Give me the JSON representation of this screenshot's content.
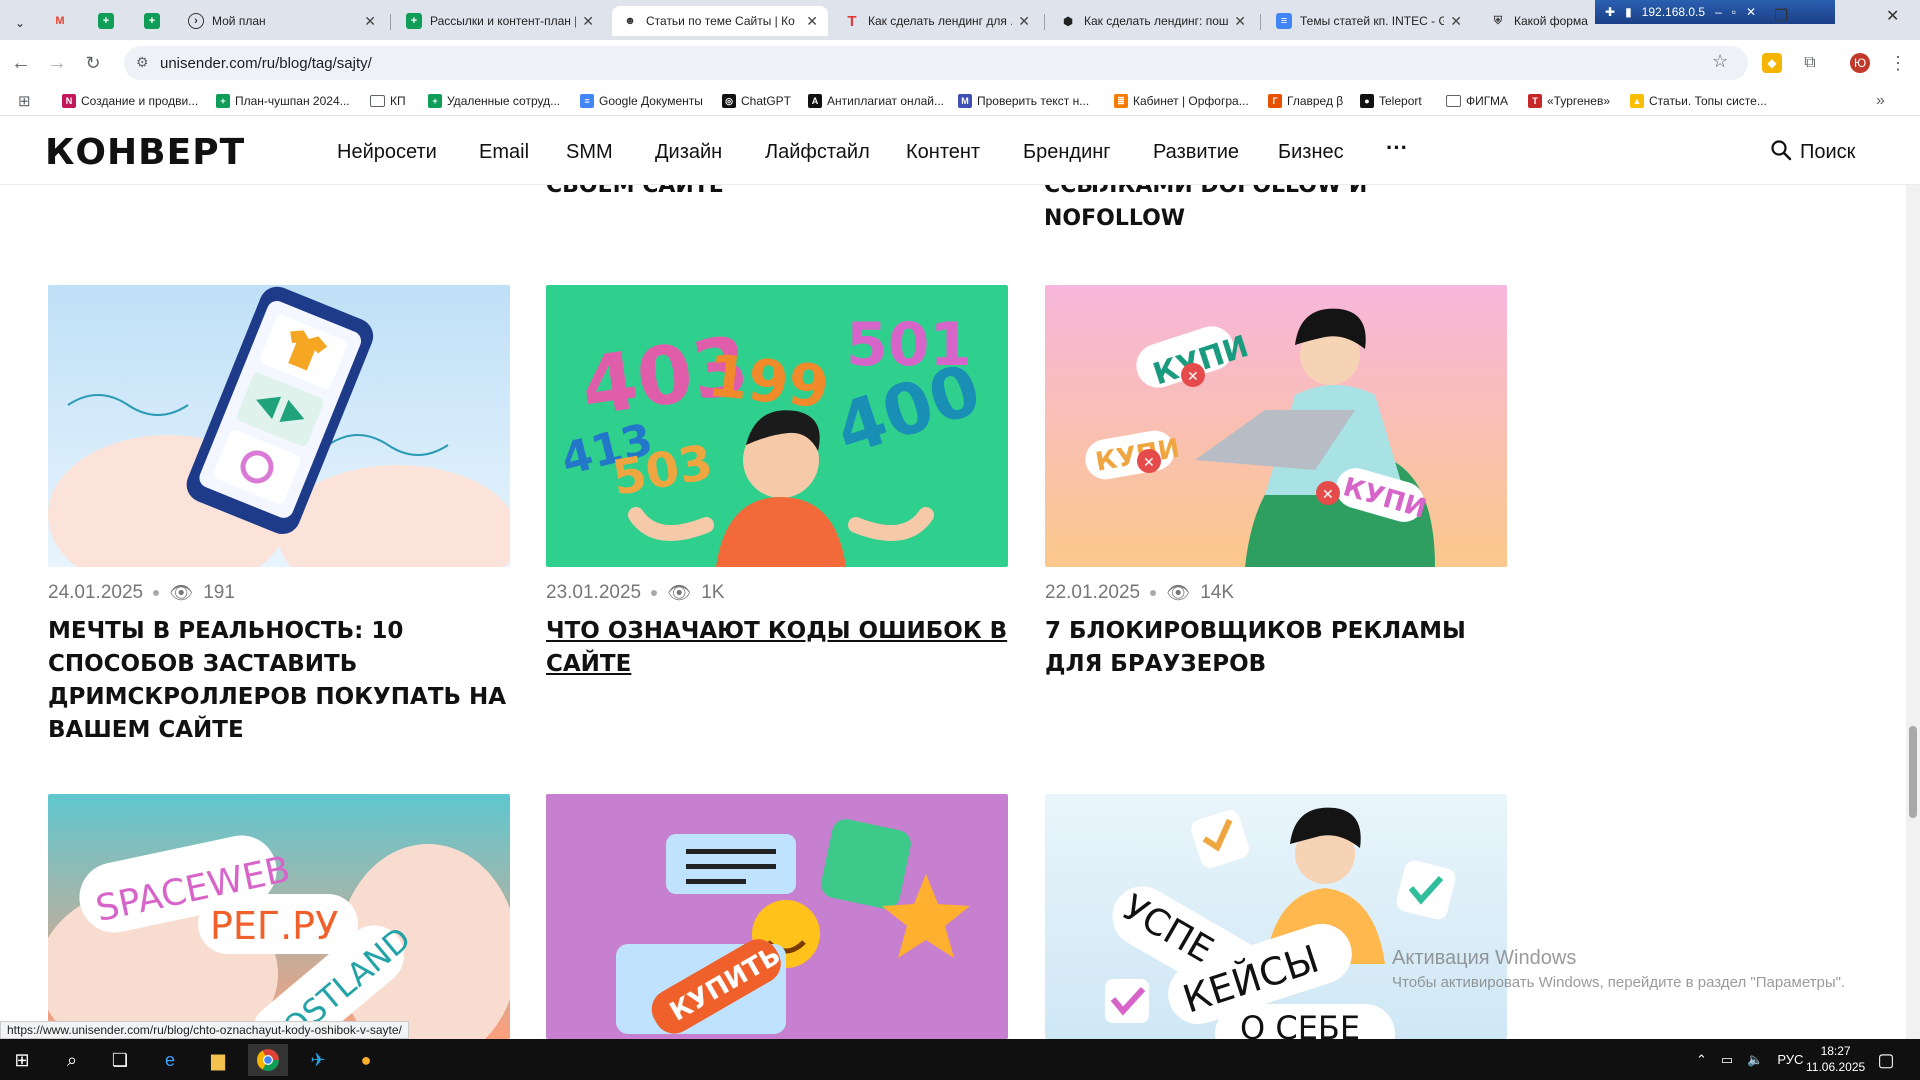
{
  "browser": {
    "tabs": [
      {
        "title": "",
        "icon": "gmail-icon",
        "color": "#ea4335"
      },
      {
        "title": "",
        "icon": "sheets-icon",
        "color": "#0f9d58"
      },
      {
        "title": "",
        "icon": "sheets-icon",
        "color": "#0f9d58"
      },
      {
        "title": "Мой план",
        "icon": "circle-arrow-icon",
        "color": "#333333"
      },
      {
        "title": "Рассылки и контент-план |",
        "icon": "sheets-icon",
        "color": "#0f9d58"
      },
      {
        "title": "Статьи по теме Сайты | Ко",
        "icon": "konvert-icon",
        "color": "#333333"
      },
      {
        "title": "Как сделать лендинг для ...",
        "icon": "text-t-icon",
        "color": "#e53935"
      },
      {
        "title": "Как сделать лендинг: пош...",
        "icon": "hex-icon",
        "color": "#222222"
      },
      {
        "title": "Темы статей кп. INTEC - G",
        "icon": "docs-icon",
        "color": "#4285f4"
      },
      {
        "title": "Какой форма",
        "icon": "shield-icon",
        "color": "#444444"
      }
    ],
    "active_tab_index": 5,
    "network_ip": "192.168.0.5",
    "url": "unisender.com/ru/blog/tag/sajty/",
    "profile_initial": "Ю"
  },
  "bookmarks": [
    {
      "label": "Создание и продви...",
      "icon": "N",
      "color": "#c2185b"
    },
    {
      "label": "План-чушпан 2024...",
      "icon": "+",
      "color": "#0f9d58"
    },
    {
      "label": "КП",
      "icon": "folder",
      "color": "#5f6368"
    },
    {
      "label": "Удаленные сотруд...",
      "icon": "+",
      "color": "#0f9d58"
    },
    {
      "label": "Google Документы",
      "icon": "≡",
      "color": "#4285f4"
    },
    {
      "label": "ChatGPT",
      "icon": "◎",
      "color": "#111111"
    },
    {
      "label": "Антиплагиат онлай...",
      "icon": "A",
      "color": "#111111"
    },
    {
      "label": "Проверить текст н...",
      "icon": "M",
      "color": "#3f51b5"
    },
    {
      "label": "Кабинет | Орфогра...",
      "icon": "≣",
      "color": "#f57c00"
    },
    {
      "label": "Главред β",
      "icon": "Г",
      "color": "#e65100"
    },
    {
      "label": "Teleport",
      "icon": "●",
      "color": "#111111"
    },
    {
      "label": "ФИГМА",
      "icon": "folder",
      "color": "#5f6368"
    },
    {
      "label": "«Тургенев»",
      "icon": "Т",
      "color": "#c62828"
    },
    {
      "label": "Статьи. Топы систе...",
      "icon": "▲",
      "color": "#fbbc04"
    }
  ],
  "site": {
    "logo": "КОНВЕРТ",
    "nav": [
      "Нейросети",
      "Email",
      "SMM",
      "Дизайн",
      "Лайфстайл",
      "Контент",
      "Брендинг",
      "Развитие",
      "Бизнес"
    ],
    "more": "···",
    "search_label": "Поиск",
    "prev_titles": [
      "СВОЕМ САЙТЕ",
      "ССЫЛКАМИ DOFOLLOW И NOFOLLOW"
    ],
    "cards": [
      {
        "date": "24.01.2025",
        "views": "191",
        "title": "МЕЧТЫ В РЕАЛЬНОСТЬ: 10 СПОСОБОВ ЗАСТАВИТЬ ДРИМСКРОЛЛЕРОВ ПОКУПАТЬ НА ВАШЕМ САЙТЕ"
      },
      {
        "date": "23.01.2025",
        "views": "1K",
        "title": "ЧТО ОЗНАЧАЮТ КОДЫ ОШИБОК В САЙТЕ"
      },
      {
        "date": "22.01.2025",
        "views": "14K",
        "title": "7 БЛОКИРОВЩИКОВ РЕКЛАМЫ ДЛЯ БРАУЗЕРОВ"
      }
    ],
    "illustration_text": {
      "codes": [
        "403",
        "199",
        "501",
        "413",
        "503",
        "400"
      ],
      "buy": [
        "КУПИ",
        "КУПИ",
        "КУПИ"
      ],
      "hosts": [
        "SPACEWEB",
        "РЕГ.РУ",
        "HOSTLAND"
      ],
      "buy2": "КУПИТЬ",
      "cases": [
        "УСПЕ",
        "КЕЙСЫ",
        "О СЕБЕ"
      ]
    }
  },
  "activation": {
    "line1": "Активация Windows",
    "line2": "Чтобы активировать Windows, перейдите в раздел \"Параметры\"."
  },
  "status_url": "https://www.unisender.com/ru/blog/chto-oznachayut-kody-oshibok-v-sayte/",
  "taskbar": {
    "language": "РУС",
    "time": "18:27",
    "date": "11.06.2025"
  }
}
